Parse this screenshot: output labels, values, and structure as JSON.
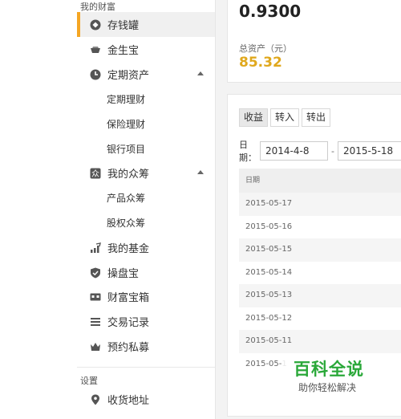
{
  "sidebar": {
    "section_wealth": "我的财富",
    "items": [
      {
        "label": "存钱罐",
        "icon": "piggy-bank-icon"
      },
      {
        "label": "金生宝",
        "icon": "gold-ingot-icon"
      },
      {
        "label": "定期资产",
        "icon": "clock-icon"
      },
      {
        "label": "定期理财"
      },
      {
        "label": "保险理财"
      },
      {
        "label": "银行项目"
      },
      {
        "label": "我的众筹",
        "icon": "crowdfunding-icon"
      },
      {
        "label": "产品众筹"
      },
      {
        "label": "股权众筹"
      },
      {
        "label": "我的基金",
        "icon": "chart-up-icon"
      },
      {
        "label": "操盘宝",
        "icon": "shield-check-icon"
      },
      {
        "label": "财富宝箱",
        "icon": "treasure-box-icon"
      },
      {
        "label": "交易记录",
        "icon": "list-icon"
      },
      {
        "label": "预约私募",
        "icon": "crown-icon"
      }
    ],
    "section_settings": "设置",
    "settings_items": [
      {
        "label": "收货地址",
        "icon": "location-pin-icon"
      }
    ]
  },
  "summary": {
    "top_value": "0.9300",
    "assets_label": "总资产（元）",
    "assets_value": "85.32"
  },
  "tabs": [
    {
      "label": "收益"
    },
    {
      "label": "转入"
    },
    {
      "label": "转出"
    }
  ],
  "filter": {
    "date_label": "日期：",
    "from": "2014-4-8",
    "separator": "-",
    "to": "2015-5-18"
  },
  "table": {
    "header": "日期",
    "rows": [
      "2015-05-17",
      "2015-05-16",
      "2015-05-15",
      "2015-05-14",
      "2015-05-13",
      "2015-05-12",
      "2015-05-11",
      "2015-05-1"
    ]
  },
  "watermark": {
    "title": "百科全说",
    "subtitle": "助你轻松解决"
  },
  "colors": {
    "accent": "#f5a623",
    "asset_value": "#e0a81d",
    "watermark_green": "#2aa839"
  }
}
